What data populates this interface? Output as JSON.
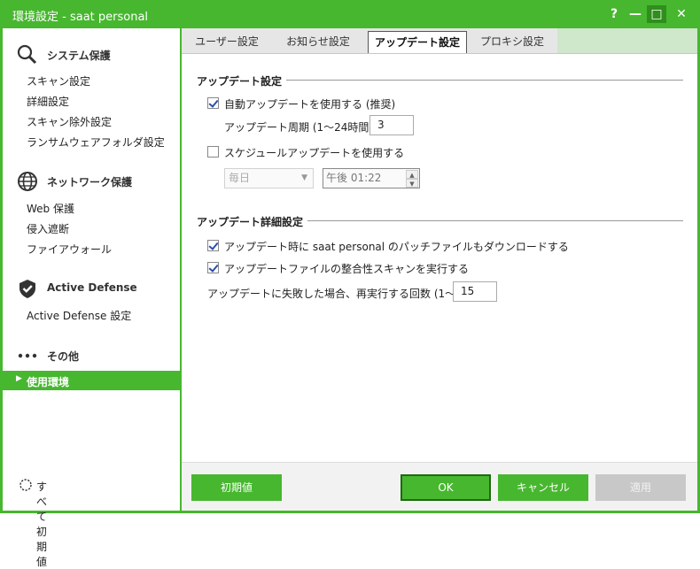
{
  "window": {
    "title": "環境設定 - saat personal",
    "controls": {
      "help": "?",
      "minimize": "—",
      "maximize": "□",
      "close": "✕"
    }
  },
  "sidebar": {
    "system": {
      "label": "システム保護",
      "icon": "search-icon",
      "items": [
        "スキャン設定",
        "詳細設定",
        "スキャン除外設定",
        "ランサムウェアフォルダ設定"
      ]
    },
    "network": {
      "label": "ネットワーク保護",
      "icon": "globe-icon",
      "items": [
        "Web 保護",
        "侵入遮断",
        "ファイアウォール"
      ]
    },
    "defense": {
      "label": "Active Defense",
      "icon": "shield-icon",
      "items": [
        "Active Defense 設定"
      ]
    },
    "other": {
      "label": "その他",
      "icon": "more-icon",
      "active_item": "使用環境"
    },
    "reset_all": "すべて初期値"
  },
  "tabs": [
    "ユーザー設定",
    "お知らせ設定",
    "アップデート設定",
    "プロキシ設定"
  ],
  "active_tab": "アップデート設定",
  "update_settings": {
    "title": "アップデート設定",
    "auto_update": {
      "label": "自動アップデートを使用する (推奨)",
      "checked": true
    },
    "cycle": {
      "label": "アップデート周期 (1〜24時間):",
      "value": "3"
    },
    "schedule": {
      "label": "スケジュールアップデートを使用する",
      "checked": false
    },
    "schedule_freq": "毎日",
    "schedule_time": "午後 01:22"
  },
  "update_advanced": {
    "title": "アップデート詳細設定",
    "patch_download": {
      "label": "アップデート時に saat personal のパッチファイルもダウンロードする",
      "checked": true
    },
    "integrity_scan": {
      "label": "アップデートファイルの整合性スキャンを実行する",
      "checked": true
    },
    "retry": {
      "label": "アップデートに失敗した場合、再実行する回数 (1〜99):",
      "value": "15"
    }
  },
  "footer": {
    "default": "初期値",
    "ok": "OK",
    "cancel": "キャンセル",
    "apply": "適用"
  },
  "colors": {
    "accent": "#47b72f",
    "tab_fill": "#cfe7cb",
    "disabled": "#c8c8c8"
  }
}
